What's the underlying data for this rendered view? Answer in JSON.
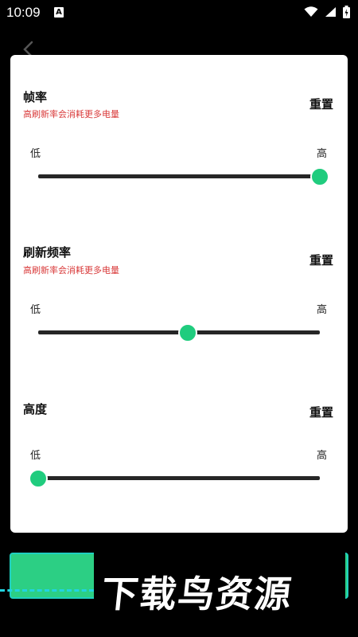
{
  "status": {
    "time": "10:09",
    "a_badge": "A"
  },
  "sections": [
    {
      "title": "帧率",
      "note": "高刷新率会消耗更多电量",
      "reset": "重置",
      "low": "低",
      "high": "高",
      "value_fraction": 1.0
    },
    {
      "title": "刷新频率",
      "note": "高刷新率会消耗更多电量",
      "reset": "重置",
      "low": "低",
      "high": "高",
      "value_fraction": 0.53
    },
    {
      "title": "高度",
      "note": "",
      "reset": "重置",
      "low": "低",
      "high": "高",
      "value_fraction": 0.0
    }
  ],
  "watermark": {
    "text": "下载鸟资源"
  },
  "colors": {
    "accent": "#20cc7e",
    "note_red": "#d93a3a",
    "track": "#262626"
  }
}
